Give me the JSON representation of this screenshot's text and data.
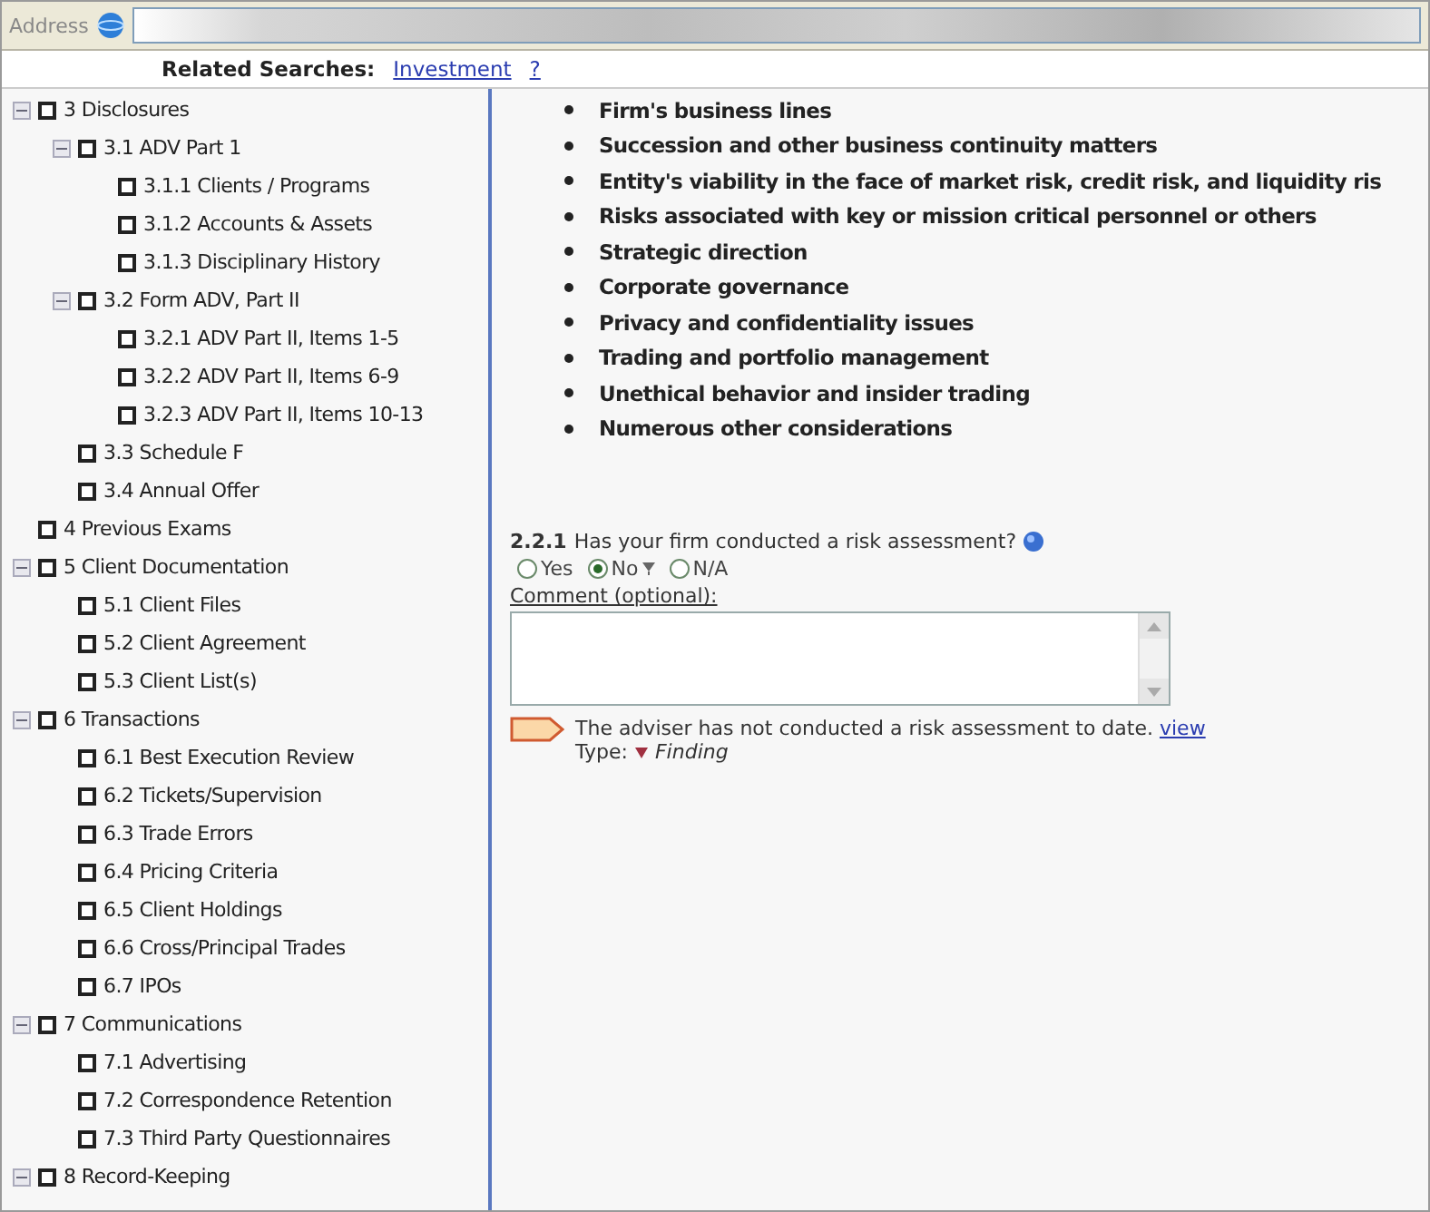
{
  "address_bar": {
    "label": "Address"
  },
  "related_searches": {
    "label": "Related Searches:",
    "links": [
      "Investment",
      "?"
    ]
  },
  "tree": [
    {
      "label": "3 Disclosures",
      "expanded": true,
      "children": [
        {
          "label": "3.1 ADV Part 1",
          "expanded": true,
          "children": [
            {
              "label": "3.1.1 Clients / Programs"
            },
            {
              "label": "3.1.2 Accounts & Assets"
            },
            {
              "label": "3.1.3 Disciplinary History"
            }
          ]
        },
        {
          "label": "3.2 Form ADV, Part II",
          "expanded": true,
          "children": [
            {
              "label": "3.2.1 ADV Part II, Items 1-5"
            },
            {
              "label": "3.2.2 ADV Part II, Items 6-9"
            },
            {
              "label": "3.2.3 ADV Part II, Items 10-13"
            }
          ]
        },
        {
          "label": "3.3 Schedule F"
        },
        {
          "label": "3.4 Annual Offer"
        }
      ]
    },
    {
      "label": "4 Previous Exams"
    },
    {
      "label": "5 Client Documentation",
      "expanded": true,
      "children": [
        {
          "label": "5.1 Client Files"
        },
        {
          "label": "5.2 Client Agreement"
        },
        {
          "label": "5.3 Client List(s)"
        }
      ]
    },
    {
      "label": "6 Transactions",
      "expanded": true,
      "children": [
        {
          "label": "6.1 Best Execution Review"
        },
        {
          "label": "6.2 Tickets/Supervision"
        },
        {
          "label": "6.3 Trade Errors"
        },
        {
          "label": "6.4 Pricing Criteria"
        },
        {
          "label": "6.5 Client Holdings"
        },
        {
          "label": "6.6 Cross/Principal Trades"
        },
        {
          "label": "6.7 IPOs"
        }
      ]
    },
    {
      "label": "7 Communications",
      "expanded": true,
      "children": [
        {
          "label": "7.1 Advertising"
        },
        {
          "label": "7.2 Correspondence Retention"
        },
        {
          "label": "7.3 Third Party Questionnaires"
        }
      ]
    },
    {
      "label": "8 Record-Keeping",
      "expanded": true
    }
  ],
  "bullets": [
    "Firm's business lines",
    "Succession and other business continuity matters",
    "Entity's viability in the face of market risk, credit risk, and liquidity ris",
    "Risks associated with key or mission critical personnel or others",
    "Strategic direction",
    "Corporate governance",
    "Privacy and confidentiality issues",
    "Trading and portfolio management",
    "Unethical behavior and insider trading",
    "Numerous other considerations"
  ],
  "question": {
    "number": "2.2.1",
    "text": "Has your firm conducted a risk assessment?",
    "options": [
      {
        "label": "Yes",
        "selected": false
      },
      {
        "label": "No",
        "selected": true
      },
      {
        "label": "N/A",
        "selected": false
      }
    ],
    "comment_label": "Comment (optional):"
  },
  "finding": {
    "text": "The adviser has not conducted a risk assessment to date.",
    "link": "view",
    "type_label": "Type:",
    "type": "Finding"
  }
}
